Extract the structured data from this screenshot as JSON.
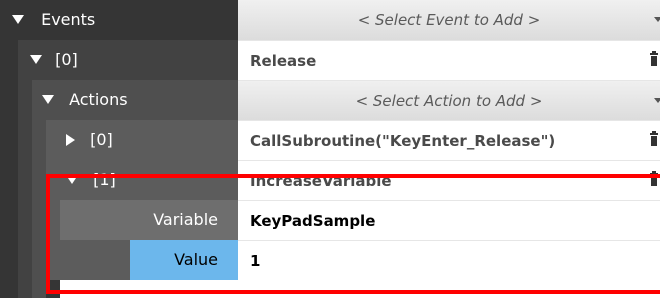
{
  "rows": {
    "events": {
      "label": "Events",
      "value": "< Select Event to Add >"
    },
    "event0": {
      "label": "[0]",
      "value": "Release"
    },
    "actions": {
      "label": "Actions",
      "value": "< Select Action to Add >"
    },
    "action0": {
      "label": "[0]",
      "value": "CallSubroutine(\"KeyEnter_Release\")"
    },
    "action1": {
      "label": "[1]",
      "value": "IncreaseVariable"
    },
    "variable": {
      "label": "Variable",
      "value": "KeyPadSample"
    },
    "value": {
      "label": "Value",
      "value": "1"
    }
  },
  "colors": {
    "level0": "#353535",
    "level1": "#424242",
    "level2": "#4f4f4f",
    "level3": "#5c5c5c",
    "level4": "#6e6e6e",
    "selected": "#6cb7ec",
    "highlight": "#ff0000"
  },
  "icons": {
    "expanded": "triangle-down-icon",
    "collapsed": "triangle-right-icon",
    "delete": "trash-icon",
    "dropdown": "dropdown-arrow-icon"
  }
}
